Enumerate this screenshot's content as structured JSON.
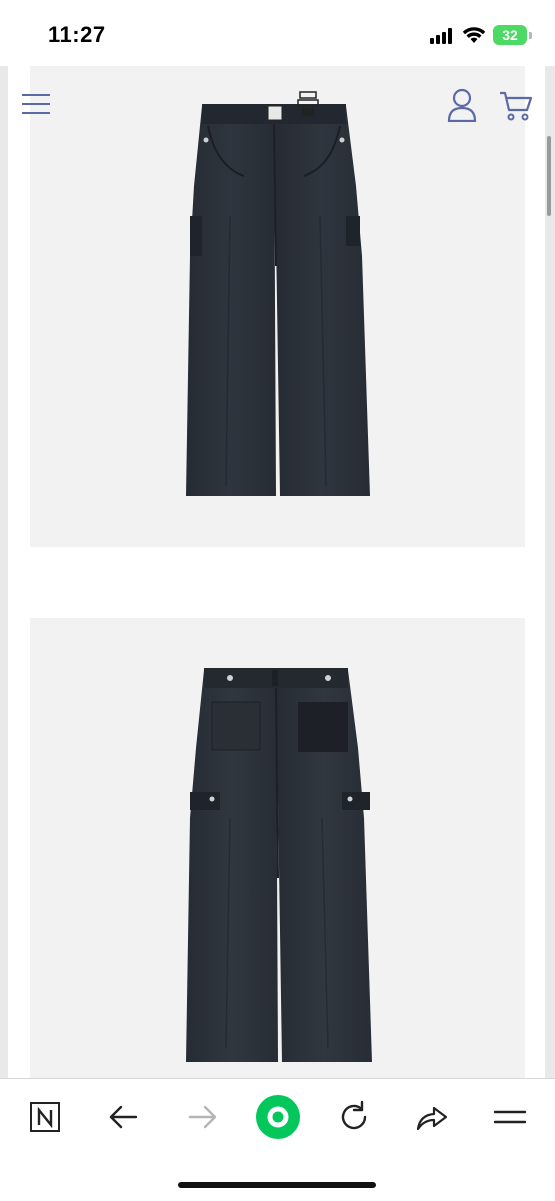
{
  "status_bar": {
    "time": "11:27",
    "battery": "32"
  },
  "header": {
    "menu_icon": "hamburger-menu-icon",
    "account_icon": "user-icon",
    "cart_icon": "shopping-cart-icon"
  },
  "products": [
    {
      "view": "front",
      "color": "#2b3038"
    },
    {
      "view": "back",
      "color": "#2e333b"
    }
  ],
  "toolbar": {
    "icons": [
      "naver-n-icon",
      "back-arrow-icon",
      "forward-arrow-icon",
      "green-dot-icon",
      "reload-icon",
      "share-icon",
      "menu-icon"
    ],
    "accent": "#03c75a"
  }
}
